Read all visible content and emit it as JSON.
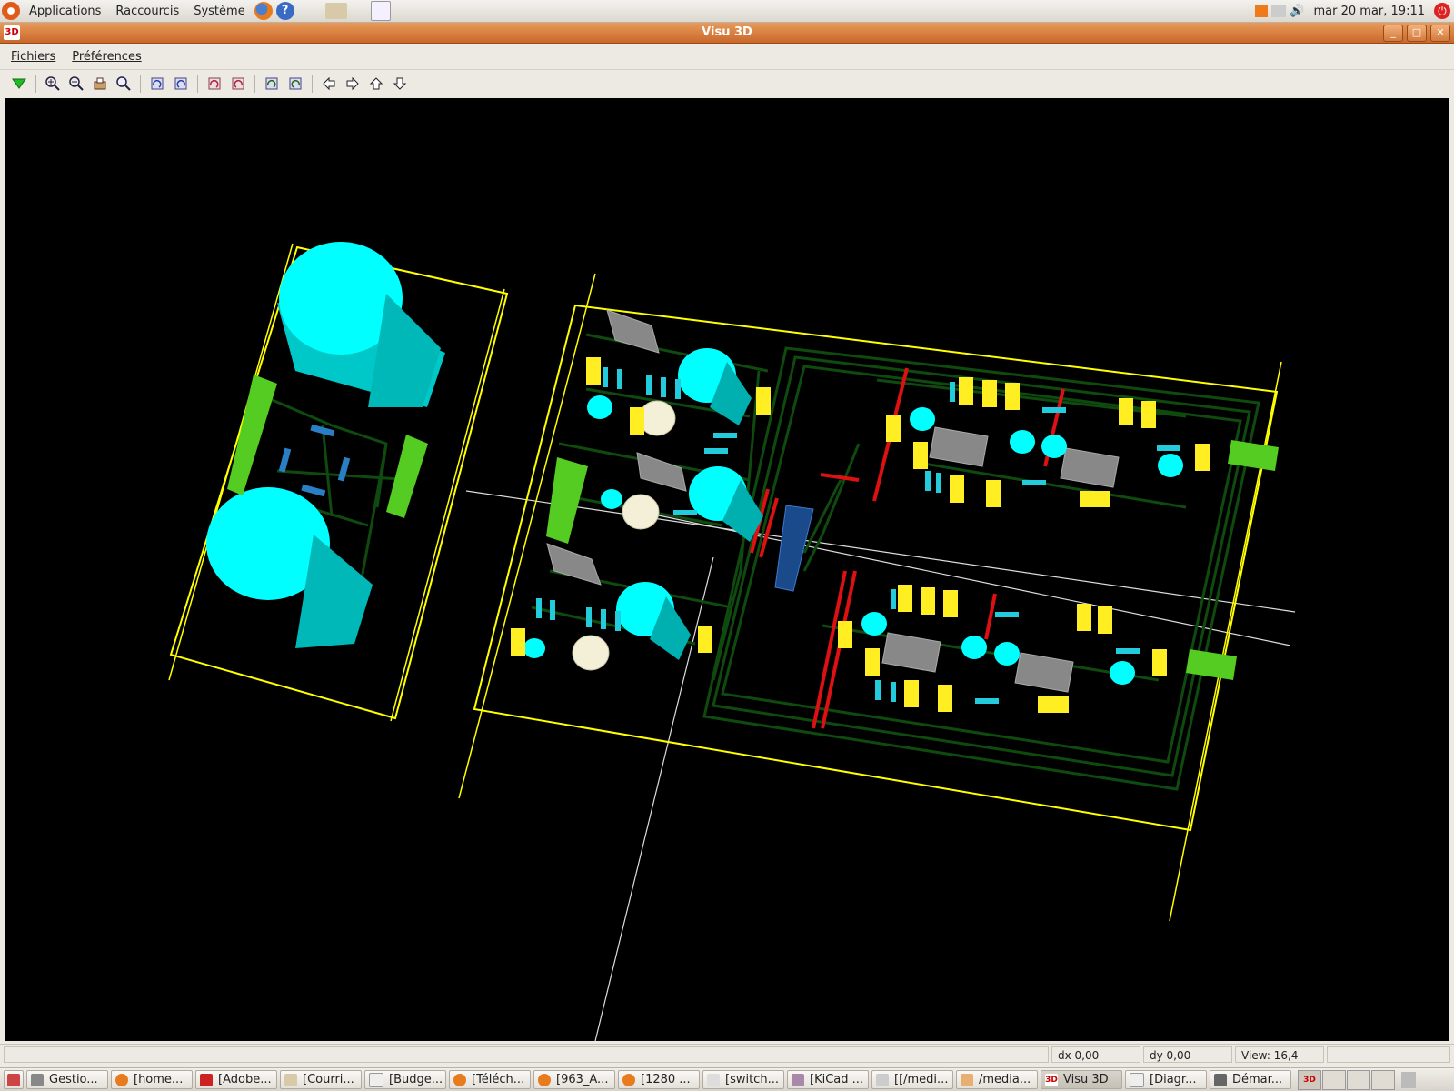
{
  "top_panel": {
    "menus": [
      "Applications",
      "Raccourcis",
      "Système"
    ],
    "clock": "mar 20 mar, 19:11"
  },
  "window": {
    "title": "Visu 3D",
    "app_icon_text": "3D",
    "menus": [
      "Fichiers",
      "Préférences"
    ]
  },
  "toolbar": {
    "icons": [
      "reload-icon",
      "zoom-in-icon",
      "zoom-out-icon",
      "redraw-icon",
      "zoom-fit-icon",
      "rotate-x-neg-icon",
      "rotate-x-pos-icon",
      "rotate-y-neg-icon",
      "rotate-y-pos-icon",
      "rotate-z-neg-icon",
      "rotate-z-pos-icon",
      "pan-left-icon",
      "pan-right-icon",
      "pan-up-icon",
      "pan-down-icon"
    ]
  },
  "status": {
    "dx": "dx 0,00",
    "dy": "dy 0,00",
    "view": "View: 16,4"
  },
  "taskbar": {
    "items": [
      "Gestio...",
      "[home...",
      "[Adobe...",
      "[Courri...",
      "[Budge...",
      "[Téléch...",
      "[963_A...",
      "[1280 ...",
      "[switch...",
      "[KiCad ...",
      "[[/medi...",
      "/media...",
      "Visu 3D",
      "[Diagr...",
      "Démar..."
    ]
  },
  "colors": {
    "canvas_bg": "#000000",
    "board_outline": "#ffff00",
    "track": "#0f4a0f",
    "capacitor": "#00e8e8",
    "connector": "#55cc22",
    "chip": "#888888",
    "smd_yellow": "#ffee22",
    "via_red": "#dd1111"
  }
}
